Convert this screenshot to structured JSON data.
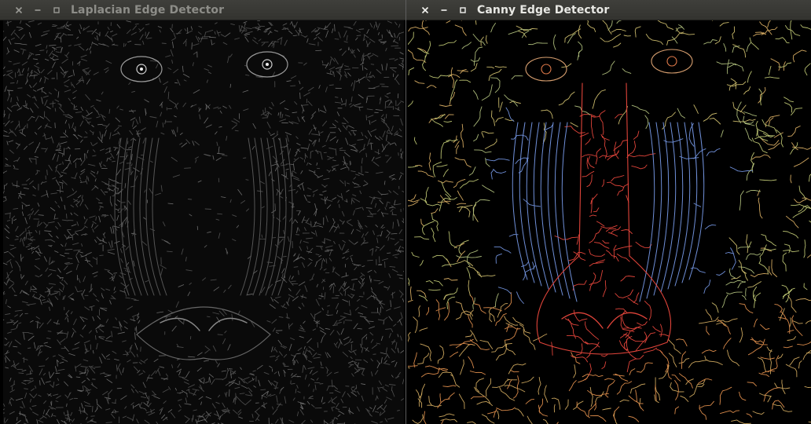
{
  "windows": [
    {
      "id": "laplacian",
      "title": "Laplacian Edge Detector",
      "image_subject": "mandrill"
    },
    {
      "id": "canny",
      "title": "Canny Edge Detector",
      "image_subject": "mandrill"
    }
  ],
  "controls": {
    "close_icon": "close-icon",
    "minimize_icon": "minimize-icon",
    "maximize_icon": "maximize-icon"
  },
  "colors": {
    "titlebar_bg": "#3a3a36",
    "active_title": "#e8e8e4",
    "inactive_title": "#8d8d88",
    "canny_red": "#e0443a",
    "canny_blue": "#6f8fd8",
    "canny_yellow": "#c8b86a"
  }
}
